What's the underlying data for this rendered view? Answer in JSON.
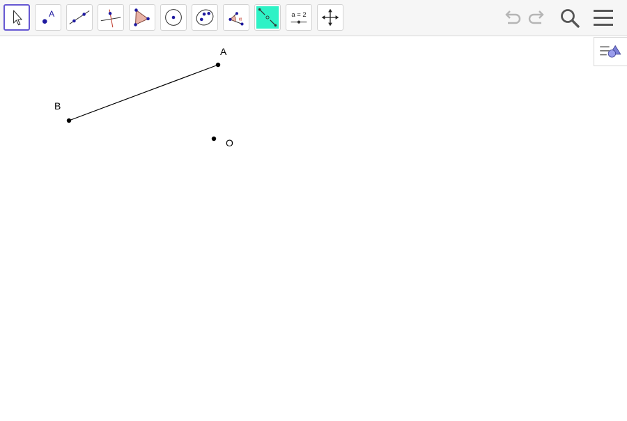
{
  "toolbar": {
    "tools": [
      {
        "name": "move-tool",
        "selected": true
      },
      {
        "name": "point-tool"
      },
      {
        "name": "line-tool"
      },
      {
        "name": "perpendicular-line-tool"
      },
      {
        "name": "polygon-tool"
      },
      {
        "name": "circle-tool"
      },
      {
        "name": "conic-tool"
      },
      {
        "name": "angle-tool"
      },
      {
        "name": "reflect-about-point-tool"
      },
      {
        "name": "slider-tool"
      },
      {
        "name": "move-graphics-view-tool"
      }
    ],
    "point_tool_label": "A",
    "slider_tool_label": "a = 2",
    "controls": [
      "undo-icon",
      "redo-icon",
      "search-icon",
      "menu-icon"
    ]
  },
  "colors": {
    "selected_border": "#6557d2",
    "point_blue": "#1f1aa0",
    "accent_teal": "#2ef2c6",
    "poly_fill": "#e8b3a6"
  },
  "graphics": {
    "points": [
      {
        "label": "A"
      },
      {
        "label": "B"
      },
      {
        "label": "O"
      }
    ],
    "segments": [
      {
        "from": "A",
        "to": "B"
      }
    ]
  }
}
